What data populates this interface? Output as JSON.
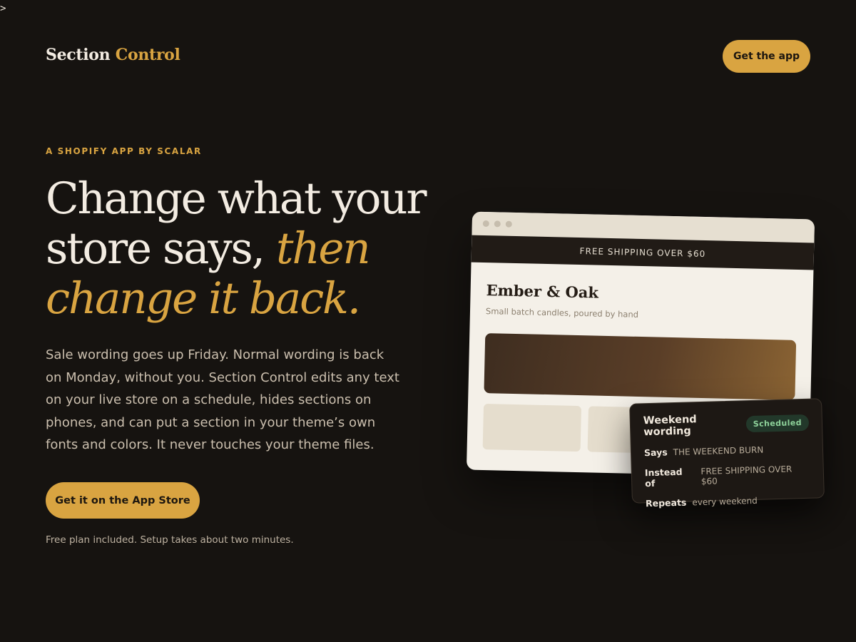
{
  "corner_glyph": ">",
  "brand": {
    "name_first": "Section",
    "name_second": "Control"
  },
  "header": {
    "cta_label": "Get the app"
  },
  "hero": {
    "eyebrow": "A SHOPIFY APP BY SCALAR",
    "headline_line1": "Change what your",
    "headline_line2": "store says, ",
    "headline_accent_1": "then",
    "headline_accent_2": "change it back.",
    "body": "Sale wording goes up Friday. Normal wording is back on Monday, without you. Section Control edits any text on your live store on a schedule, hides sections on phones, and can put a section in your theme’s own fonts and colors. It never touches your theme files.",
    "cta_label": "Get it on the App Store",
    "fine_print": "Free plan included. Setup takes about two minutes."
  },
  "preview": {
    "banner": "FREE SHIPPING OVER $60",
    "store_name": "Ember & Oak",
    "store_tagline": "Small batch candles, poured by hand",
    "schedule_card": {
      "title": "Weekend wording",
      "badge": "Scheduled",
      "rows": [
        {
          "label": "Says",
          "value": "THE WEEKEND BURN"
        },
        {
          "label": "Instead of",
          "value": "FREE SHIPPING OVER $60"
        },
        {
          "label": "Repeats",
          "value": "every weekend"
        }
      ]
    }
  },
  "colors": {
    "background": "#161310",
    "accent": "#d9a441",
    "text": "#f3ece2",
    "status_green": "#8ed29a"
  }
}
